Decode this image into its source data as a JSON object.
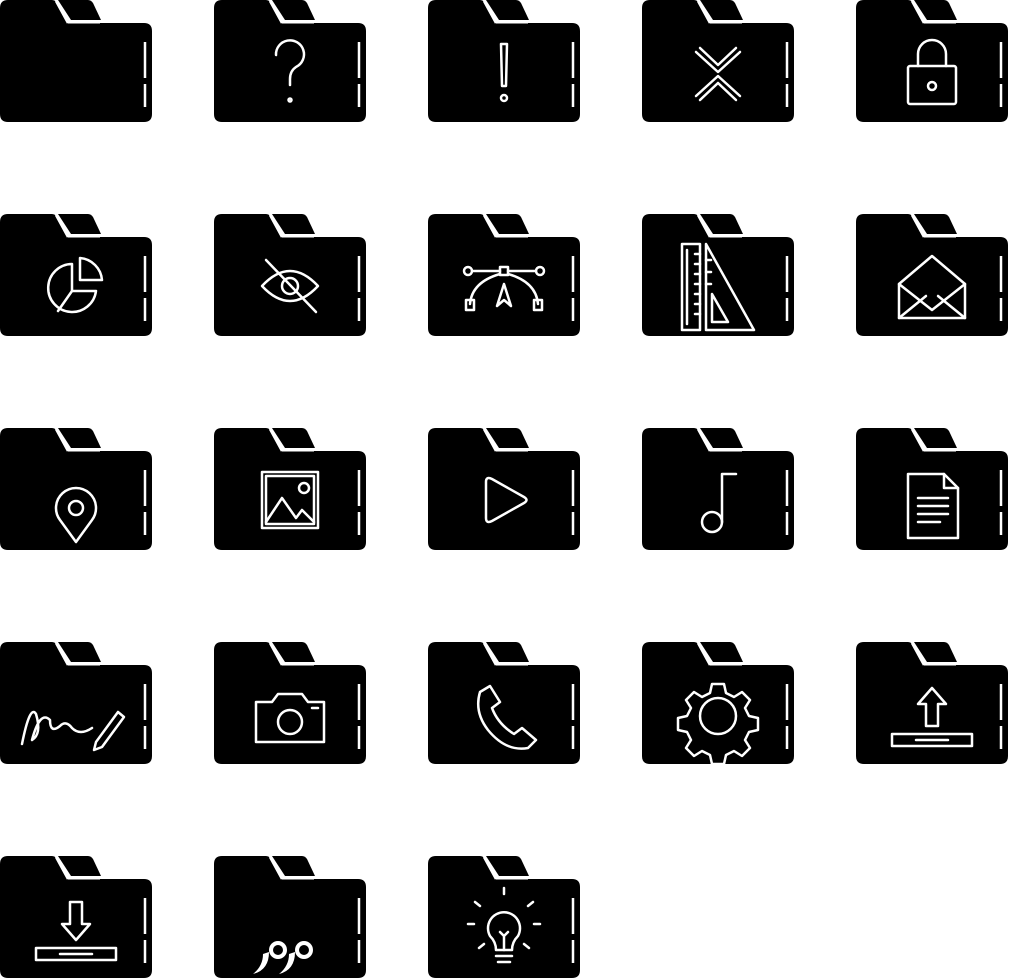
{
  "colors": {
    "folder": "#000000",
    "stroke": "#ffffff",
    "background": "#ffffff"
  },
  "icons": [
    "folder-icon",
    "folder-question-icon",
    "folder-alert-icon",
    "folder-delete-icon",
    "folder-lock-icon",
    "folder-chart-icon",
    "folder-hidden-icon",
    "folder-vector-icon",
    "folder-ruler-icon",
    "folder-mail-icon",
    "folder-location-icon",
    "folder-image-icon",
    "folder-video-icon",
    "folder-music-icon",
    "folder-document-icon",
    "folder-signature-icon",
    "folder-camera-icon",
    "folder-phone-icon",
    "folder-settings-icon",
    "folder-upload-icon",
    "folder-download-icon",
    "folder-quote-icon",
    "folder-idea-icon"
  ]
}
